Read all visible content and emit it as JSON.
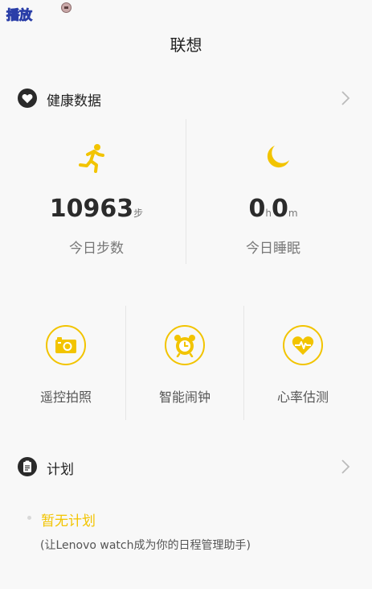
{
  "status_bar": {
    "label": "播放"
  },
  "header": {
    "title": "联想"
  },
  "health": {
    "title": "健康数据",
    "steps": {
      "value": "10963",
      "unit": "步",
      "label": "今日步数"
    },
    "sleep": {
      "hours": "0",
      "hours_unit": "h",
      "minutes": "0",
      "minutes_unit": "m",
      "label": "今日睡眠"
    }
  },
  "tools": [
    {
      "label": "遥控拍照",
      "icon": "camera-icon"
    },
    {
      "label": "智能闹钟",
      "icon": "alarm-clock-icon"
    },
    {
      "label": "心率估测",
      "icon": "heart-rate-icon"
    }
  ],
  "plan": {
    "title": "计划",
    "empty_text": "暂无计划",
    "hint": "(让Lenovo watch成为你的日程管理助手)"
  },
  "colors": {
    "accent": "#f2c400",
    "background": "#f8f8f8",
    "text_primary": "#222222",
    "text_secondary": "#777777"
  }
}
